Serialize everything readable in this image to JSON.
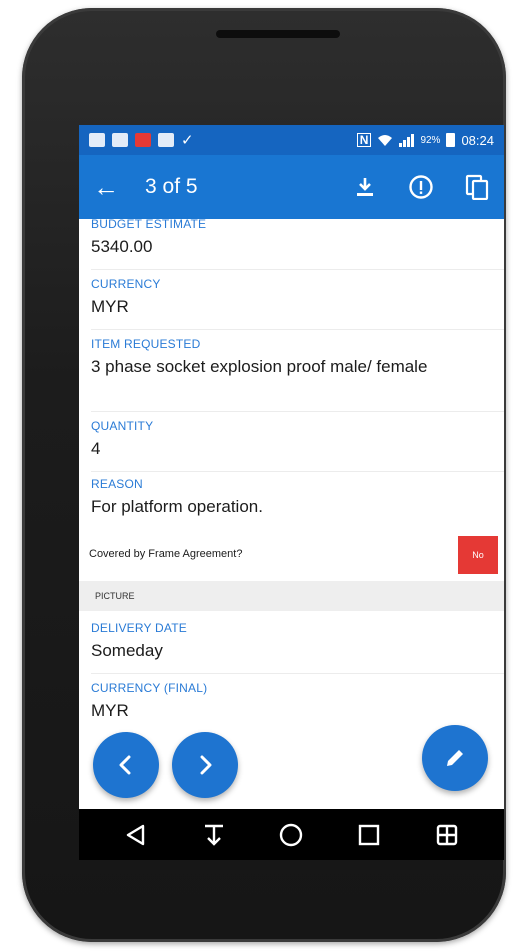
{
  "status_bar": {
    "battery": "92%",
    "time": "08:24"
  },
  "app_bar": {
    "title": "3 of 5",
    "actions": [
      "download-icon",
      "info-icon",
      "copy-icon"
    ]
  },
  "fields": [
    {
      "label": "BUDGET ESTIMATE",
      "value": "5340.00"
    },
    {
      "label": "CURRENCY",
      "value": "MYR"
    },
    {
      "label": "ITEM REQUESTED",
      "value": "3 phase socket explosion proof male/ female"
    },
    {
      "label": "QUANTITY",
      "value": "4"
    },
    {
      "label": "REASON",
      "value": "For platform operation."
    }
  ],
  "frame_agreement": {
    "label": "Covered by Frame Agreement?",
    "toggle": "No"
  },
  "section": {
    "title": "PICTURE"
  },
  "fields_after": [
    {
      "label": "DELIVERY DATE",
      "value": "Someday"
    },
    {
      "label": "CURRENCY (FINAL)",
      "value": "MYR"
    }
  ],
  "colors": {
    "primary": "#1976d2",
    "status_bar": "#1565c0",
    "accent_label": "#2a7bd6",
    "toggle_no": "#e53935"
  }
}
